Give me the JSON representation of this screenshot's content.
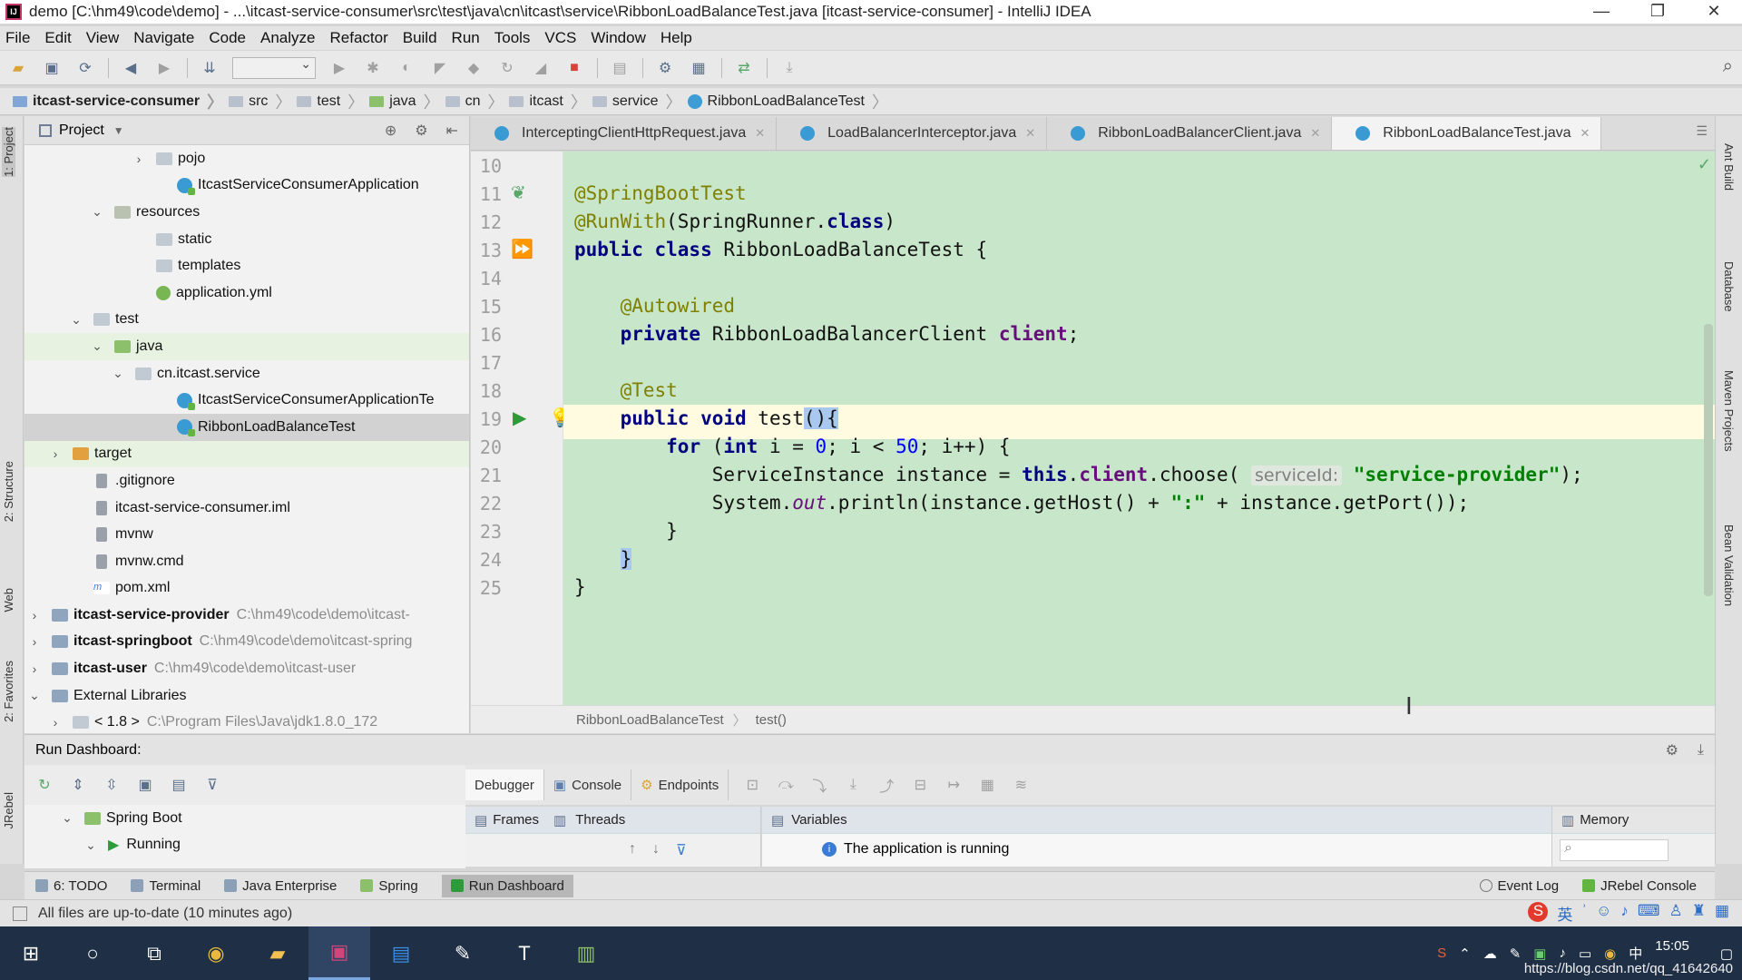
{
  "window": {
    "title": "demo [C:\\hm49\\code\\demo] - ...\\itcast-service-consumer\\src\\test\\java\\cn\\itcast\\service\\RibbonLoadBalanceTest.java [itcast-service-consumer] - IntelliJ IDEA",
    "app_icon": "IJ",
    "minimize": "—",
    "restore": "❐",
    "close": "✕"
  },
  "menu": [
    "File",
    "Edit",
    "View",
    "Navigate",
    "Code",
    "Analyze",
    "Refactor",
    "Build",
    "Run",
    "Tools",
    "VCS",
    "Window",
    "Help"
  ],
  "breadcrumb": [
    "itcast-service-consumer",
    "src",
    "test",
    "java",
    "cn",
    "itcast",
    "service",
    "RibbonLoadBalanceTest"
  ],
  "project": {
    "title": "Project",
    "tree": [
      {
        "label": "pojo",
        "indent": 5,
        "arrow": "›",
        "icon": "folder"
      },
      {
        "label": "ItcastServiceConsumerApplication",
        "indent": 6,
        "arrow": "",
        "icon": "cls"
      },
      {
        "label": "resources",
        "indent": 3,
        "arrow": "⌄",
        "icon": "res"
      },
      {
        "label": "static",
        "indent": 5,
        "arrow": "",
        "icon": "folder"
      },
      {
        "label": "templates",
        "indent": 5,
        "arrow": "",
        "icon": "folder"
      },
      {
        "label": "application.yml",
        "indent": 5,
        "arrow": "",
        "icon": "yml"
      },
      {
        "label": "test",
        "indent": 2,
        "arrow": "⌄",
        "icon": "folder"
      },
      {
        "label": "java",
        "indent": 3,
        "arrow": "⌄",
        "icon": "green",
        "highlight": true
      },
      {
        "label": "cn.itcast.service",
        "indent": 4,
        "arrow": "⌄",
        "icon": "folder"
      },
      {
        "label": "ItcastServiceConsumerApplicationTe",
        "indent": 6,
        "arrow": "",
        "icon": "cls"
      },
      {
        "label": "RibbonLoadBalanceTest",
        "indent": 6,
        "arrow": "",
        "icon": "cls",
        "selected": true
      },
      {
        "label": "target",
        "indent": 1,
        "arrow": "›",
        "icon": "orange",
        "highlight": true
      },
      {
        "label": ".gitignore",
        "indent": 2,
        "arrow": "",
        "icon": "file"
      },
      {
        "label": "itcast-service-consumer.iml",
        "indent": 2,
        "arrow": "",
        "icon": "file"
      },
      {
        "label": "mvnw",
        "indent": 2,
        "arrow": "",
        "icon": "file"
      },
      {
        "label": "mvnw.cmd",
        "indent": 2,
        "arrow": "",
        "icon": "file"
      },
      {
        "label": "pom.xml",
        "indent": 2,
        "arrow": "",
        "icon": "xml"
      },
      {
        "label": "itcast-service-provider",
        "path": "C:\\hm49\\code\\demo\\itcast-",
        "indent": 0,
        "arrow": "›",
        "icon": "mod",
        "bold": true
      },
      {
        "label": "itcast-springboot",
        "path": "C:\\hm49\\code\\demo\\itcast-spring",
        "indent": 0,
        "arrow": "›",
        "icon": "mod",
        "bold": true
      },
      {
        "label": "itcast-user",
        "path": "C:\\hm49\\code\\demo\\itcast-user",
        "indent": 0,
        "arrow": "›",
        "icon": "mod",
        "bold": true
      },
      {
        "label": "External Libraries",
        "indent": 0,
        "arrow": "⌄",
        "icon": "mod"
      },
      {
        "label": "< 1.8 >",
        "path": "C:\\Program Files\\Java\\jdk1.8.0_172",
        "indent": 1,
        "arrow": "›",
        "icon": "folder"
      }
    ]
  },
  "tabs": [
    {
      "label": "InterceptingClientHttpRequest.java",
      "active": false
    },
    {
      "label": "LoadBalancerInterceptor.java",
      "active": false
    },
    {
      "label": "RibbonLoadBalancerClient.java",
      "active": false
    },
    {
      "label": "RibbonLoadBalanceTest.java",
      "active": true
    }
  ],
  "code": {
    "lines": [
      {
        "n": "10",
        "html": ""
      },
      {
        "n": "11",
        "html": "<span class='ann'>@SpringBootTest</span>"
      },
      {
        "n": "12",
        "html": "<span class='ann'>@RunWith</span>(SpringRunner.<span class='kw'>class</span>)"
      },
      {
        "n": "13",
        "html": "<span class='kw'>public class</span> RibbonLoadBalanceTest {"
      },
      {
        "n": "14",
        "html": ""
      },
      {
        "n": "15",
        "html": "    <span class='ann'>@Autowired</span>"
      },
      {
        "n": "16",
        "html": "    <span class='kw'>private</span> RibbonLoadBalancerClient <span class='fld'>client</span>;"
      },
      {
        "n": "17",
        "html": ""
      },
      {
        "n": "18",
        "html": "    <span class='ann'>@Test</span>"
      },
      {
        "n": "19",
        "html": "    <span class='kw'>public void</span> test<span class='brace-hl'>(){</span>"
      },
      {
        "n": "20",
        "html": "        <span class='kw'>for</span> (<span class='kw'>int</span> i = <span class='num'>0</span>; i &lt; <span class='num'>50</span>; i++) {"
      },
      {
        "n": "21",
        "html": "            ServiceInstance instance = <span class='kw'>this</span>.<span class='fld'>client</span>.choose( <span class='hint'>serviceId:</span> <span class='str'>\"service-provider\"</span>);"
      },
      {
        "n": "22",
        "html": "            System.<span class='stat'>out</span>.println(instance.getHost() + <span class='str'>\":\"</span> + instance.getPort());"
      },
      {
        "n": "23",
        "html": "        }"
      },
      {
        "n": "24",
        "html": "    <span class='brace-hl'>}</span>"
      },
      {
        "n": "25",
        "html": "}"
      }
    ],
    "caret_line": 9
  },
  "editor_breadcrumb": [
    "RibbonLoadBalanceTest",
    "test()"
  ],
  "run": {
    "header": "Run Dashboard:",
    "tree": [
      {
        "label": "Spring Boot",
        "indent": 0
      },
      {
        "label": "Running",
        "indent": 1
      }
    ],
    "debugger_tabs": [
      "Debugger",
      "Console",
      "Endpoints"
    ],
    "frames_label": "Frames",
    "threads_label": "Threads",
    "variables_label": "Variables",
    "memory_label": "Memory",
    "status_message": "The application is running"
  },
  "bottom_tools": [
    "6: TODO",
    "Terminal",
    "Java Enterprise",
    "Spring",
    "Run Dashboard"
  ],
  "bottom_tools_right": [
    "Event Log",
    "JRebel Console"
  ],
  "status": "All files are up-to-date (10 minutes ago)",
  "left_strip": [
    "1: Project",
    "2: Structure",
    "Web",
    "2: Favorites",
    "JRebel"
  ],
  "right_strip": [
    "Ant Build",
    "Database",
    "Maven Projects",
    "Bean Validation"
  ],
  "taskbar": {
    "clock": "15:05",
    "watermark": "https://blog.csdn.net/qq_41642640"
  }
}
